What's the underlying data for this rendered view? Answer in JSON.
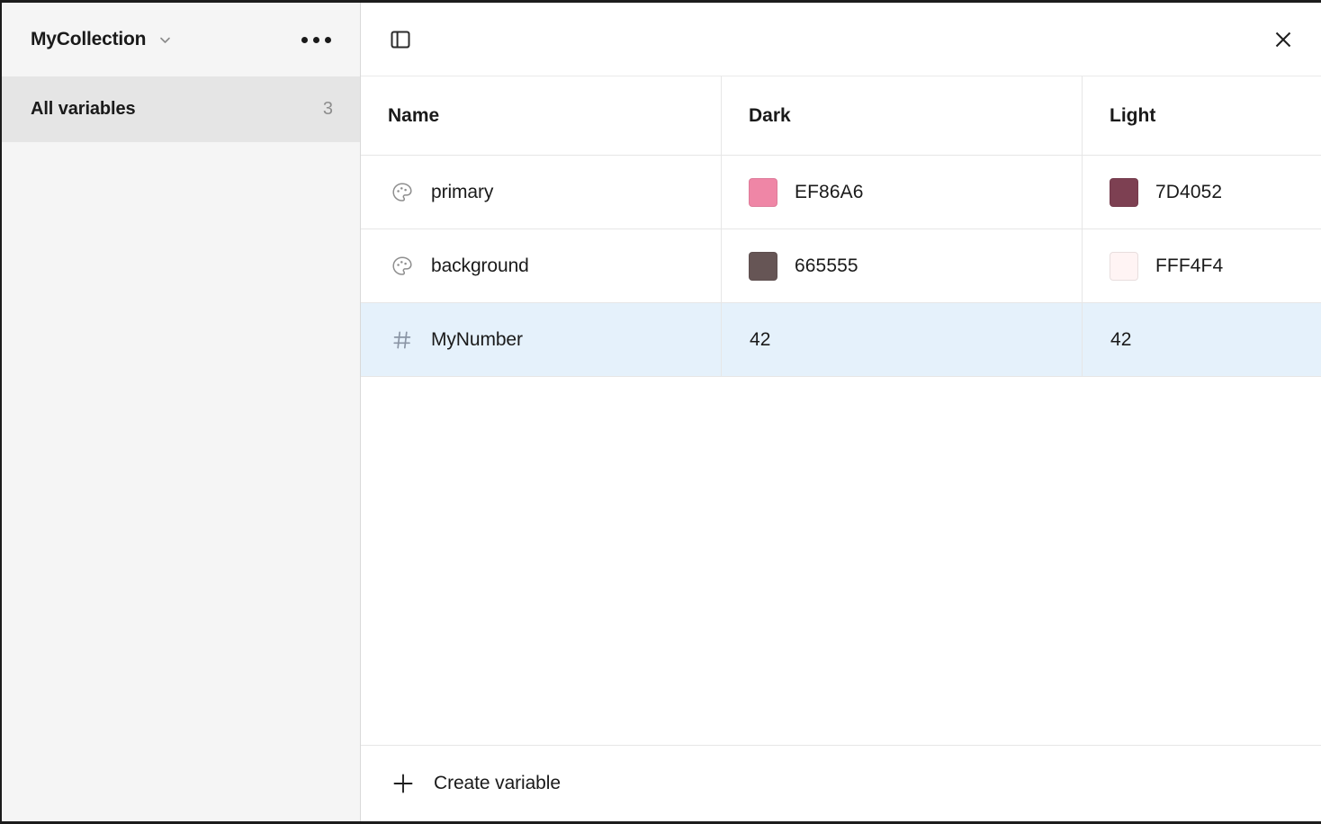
{
  "sidebar": {
    "collection": {
      "title": "MyCollection",
      "chevron_icon": "chevron-down-icon",
      "menu_icon": "ellipsis-icon"
    },
    "items": [
      {
        "label": "All variables",
        "count": "3",
        "selected": true
      }
    ]
  },
  "toolbar": {
    "panel_toggle_icon": "sidebar-panel-icon",
    "close_icon": "close-icon"
  },
  "table": {
    "columns": [
      "Name",
      "Dark",
      "Light"
    ],
    "rows": [
      {
        "icon": "color-palette-icon",
        "name": "primary",
        "dark": {
          "value": "EF86A6",
          "swatch": "#EF86A6",
          "type": "color"
        },
        "light": {
          "value": "7D4052",
          "swatch": "#7D4052",
          "type": "color"
        },
        "selected": false
      },
      {
        "icon": "color-palette-icon",
        "name": "background",
        "dark": {
          "value": "665555",
          "swatch": "#665555",
          "type": "color"
        },
        "light": {
          "value": "FFF4F4",
          "swatch": "#FFF4F4",
          "type": "color"
        },
        "selected": false
      },
      {
        "icon": "number-hash-icon",
        "name": "MyNumber",
        "dark": {
          "value": "42",
          "type": "number"
        },
        "light": {
          "value": "42",
          "type": "number"
        },
        "selected": true
      }
    ]
  },
  "footer": {
    "create_label": "Create variable",
    "create_icon": "plus-icon"
  },
  "colors": {
    "selected_row": "#E5F1FB",
    "sidebar_bg": "#F5F5F5",
    "sidebar_selected": "#E5E5E5",
    "border": "#E6E6E6",
    "text": "#1A1A1A",
    "muted_text": "#8D8D8D"
  }
}
